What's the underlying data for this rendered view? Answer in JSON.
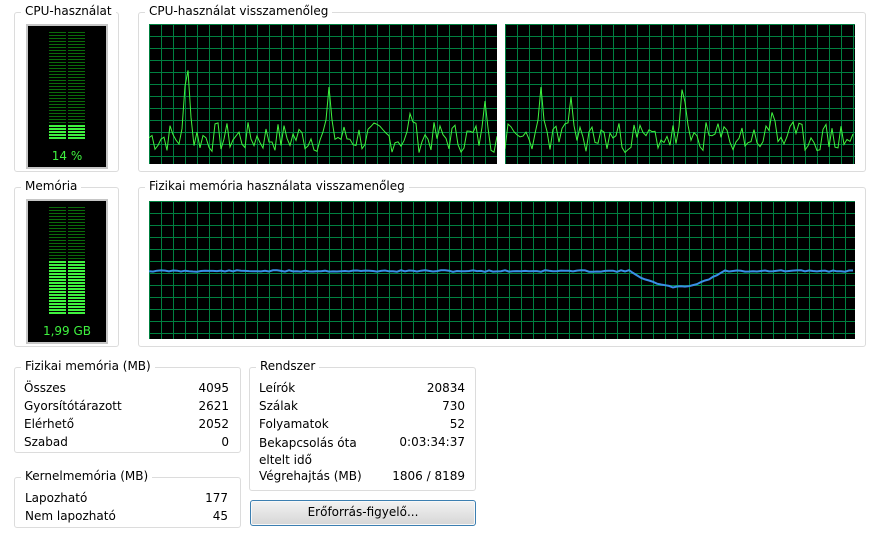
{
  "cpu_usage": {
    "title": "CPU-használat",
    "value": "14 %",
    "level": 0.14
  },
  "cpu_history": {
    "title": "CPU-használat visszamenőleg"
  },
  "memory": {
    "title": "Memória",
    "value": "1,99 GB",
    "level": 0.49
  },
  "memory_history": {
    "title": "Fizikai memória használata visszamenőleg"
  },
  "physical_memory": {
    "title": "Fizikai memória (MB)",
    "rows": [
      {
        "label": "Összes",
        "value": "4095"
      },
      {
        "label": "Gyorsítótárazott",
        "value": "2621"
      },
      {
        "label": "Elérhető",
        "value": "2052"
      },
      {
        "label": "Szabad",
        "value": "0"
      }
    ]
  },
  "kernel_memory": {
    "title": "Kernelmemória (MB)",
    "rows": [
      {
        "label": "Lapozható",
        "value": "177"
      },
      {
        "label": "Nem lapozható",
        "value": "45"
      }
    ]
  },
  "system": {
    "title": "Rendszer",
    "rows": [
      {
        "label": "Leírók",
        "value": "20834"
      },
      {
        "label": "Szálak",
        "value": "730"
      },
      {
        "label": "Folyamatok",
        "value": "52"
      },
      {
        "label": "Bekapcsolás óta eltelt idő",
        "value": "0:03:34:37"
      },
      {
        "label": "Végrehajtás (MB)",
        "value": "1806 / 8189"
      }
    ]
  },
  "resource_monitor_button": {
    "label": "Erőforrás-figyelő..."
  },
  "colors": {
    "meter": "#3ff23f",
    "grid": "#008040",
    "cpu_line": "#3ff23f",
    "memory_line": "#3a8ee6"
  }
}
